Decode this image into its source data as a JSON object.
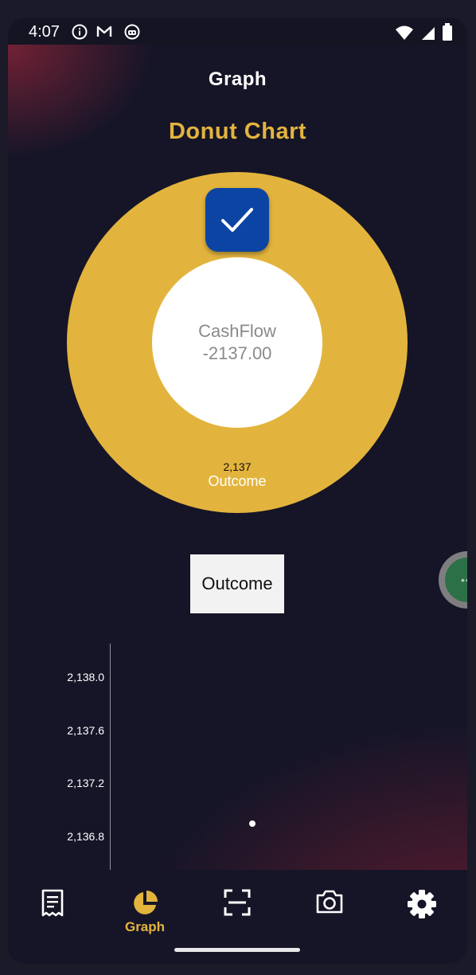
{
  "status_bar": {
    "time": "4:07",
    "icons": [
      "info-icon",
      "gmail-icon",
      "app-icon",
      "wifi-icon",
      "signal-icon",
      "battery-icon"
    ]
  },
  "header": {
    "title": "Graph"
  },
  "chart_header": {
    "title": "Donut Chart"
  },
  "donut": {
    "center_label": "CashFlow",
    "center_value": "-2137.00",
    "check_icon": "check-icon",
    "color": "#e3b43d"
  },
  "legend": {
    "label": "Outcome"
  },
  "chart_data": [
    {
      "type": "pie",
      "title": "Donut Chart",
      "donut": true,
      "categories": [
        "Outcome"
      ],
      "values": [
        2137
      ],
      "data_labels": [
        "2,137"
      ],
      "colors": [
        "#e3b43d"
      ]
    },
    {
      "type": "scatter",
      "x": [
        0
      ],
      "y": [
        2136.9
      ],
      "yticks": [
        "2,138.0",
        "2,137.6",
        "2,137.2",
        "2,136.8"
      ],
      "ylim": [
        2136.6,
        2138.2
      ]
    }
  ],
  "nav": {
    "items": [
      {
        "icon": "receipt-icon",
        "label": ""
      },
      {
        "icon": "pie-chart-icon",
        "label": "Graph",
        "active": true
      },
      {
        "icon": "scan-icon",
        "label": ""
      },
      {
        "icon": "camera-icon",
        "label": ""
      },
      {
        "icon": "settings-icon",
        "label": ""
      }
    ]
  },
  "colors": {
    "accent": "#e3b43d",
    "background": "#161527",
    "check_button": "#0b44a3"
  }
}
